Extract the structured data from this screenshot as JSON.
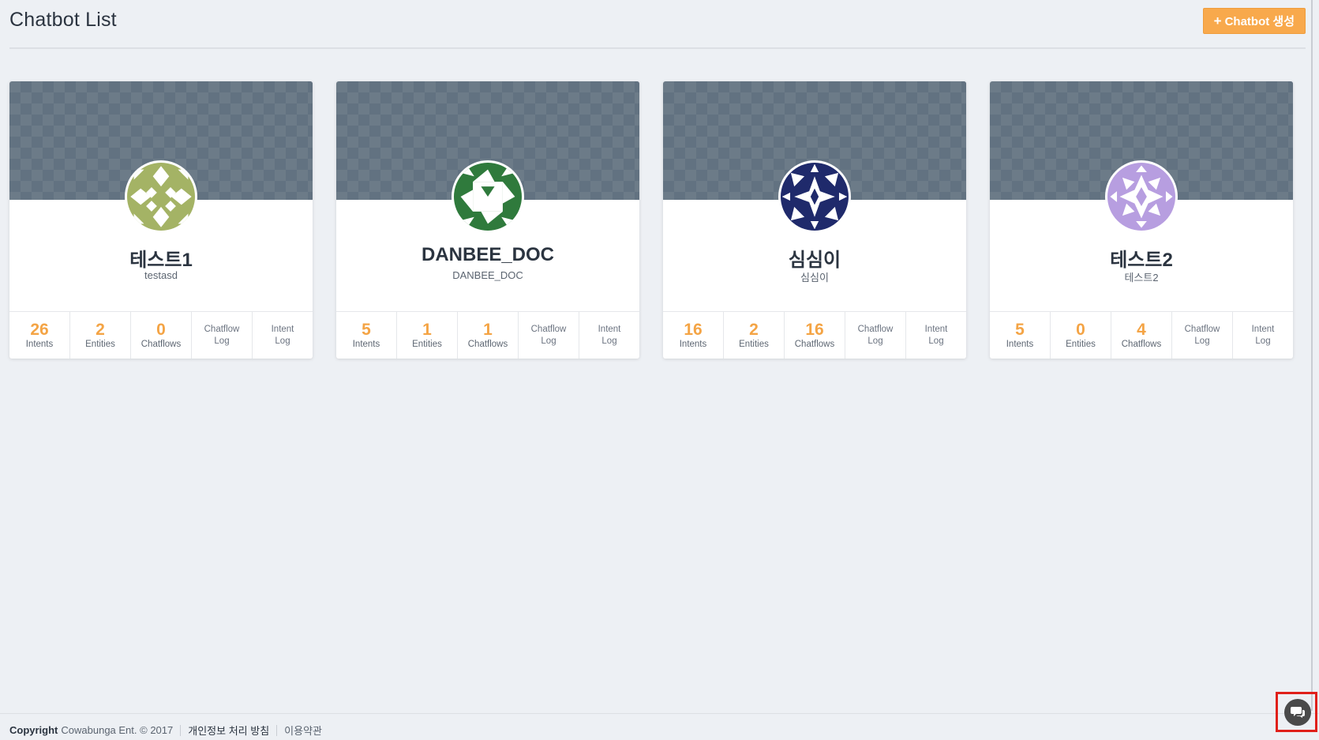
{
  "page": {
    "title": "Chatbot List",
    "create_button": {
      "icon": "plus-icon",
      "label": "Chatbot 생성",
      "color": "#f8a94c"
    }
  },
  "chatbots": [
    {
      "name": "테스트1",
      "subtitle": "testasd",
      "avatar_color": "#a4b365",
      "stats": {
        "intents": "26",
        "intents_label": "Intents",
        "entities": "2",
        "entities_label": "Entities",
        "chatflows": "0",
        "chatflows_label": "Chatflows"
      },
      "chatflow_log": [
        "Chatflow",
        "Log"
      ],
      "intent_log": [
        "Intent",
        "Log"
      ]
    },
    {
      "name": "DANBEE_DOC",
      "subtitle": "DANBEE_DOC",
      "avatar_color": "#2f7a3c",
      "stats": {
        "intents": "5",
        "intents_label": "Intents",
        "entities": "1",
        "entities_label": "Entities",
        "chatflows": "1",
        "chatflows_label": "Chatflows"
      },
      "chatflow_log": [
        "Chatflow",
        "Log"
      ],
      "intent_log": [
        "Intent",
        "Log"
      ]
    },
    {
      "name": "심심이",
      "subtitle": "심심이",
      "avatar_color": "#1f2a6b",
      "stats": {
        "intents": "16",
        "intents_label": "Intents",
        "entities": "2",
        "entities_label": "Entities",
        "chatflows": "16",
        "chatflows_label": "Chatflows"
      },
      "chatflow_log": [
        "Chatflow",
        "Log"
      ],
      "intent_log": [
        "Intent",
        "Log"
      ]
    },
    {
      "name": "테스트2",
      "subtitle": "테스트2",
      "avatar_color": "#b79ee0",
      "stats": {
        "intents": "5",
        "intents_label": "Intents",
        "entities": "0",
        "entities_label": "Entities",
        "chatflows": "4",
        "chatflows_label": "Chatflows"
      },
      "chatflow_log": [
        "Chatflow",
        "Log"
      ],
      "intent_log": [
        "Intent",
        "Log"
      ]
    }
  ],
  "footer": {
    "copyright_bold": "Copyright",
    "copyright_text": "Cowabunga Ent. © 2017",
    "privacy_link": "개인정보 처리 방침",
    "terms_link": "이용약관"
  },
  "chat_fab": {
    "icon": "chat-bubbles-icon"
  },
  "colors": {
    "accent": "#f8a94c",
    "stat_value": "#f4a445",
    "banner": "#6c7b88"
  }
}
